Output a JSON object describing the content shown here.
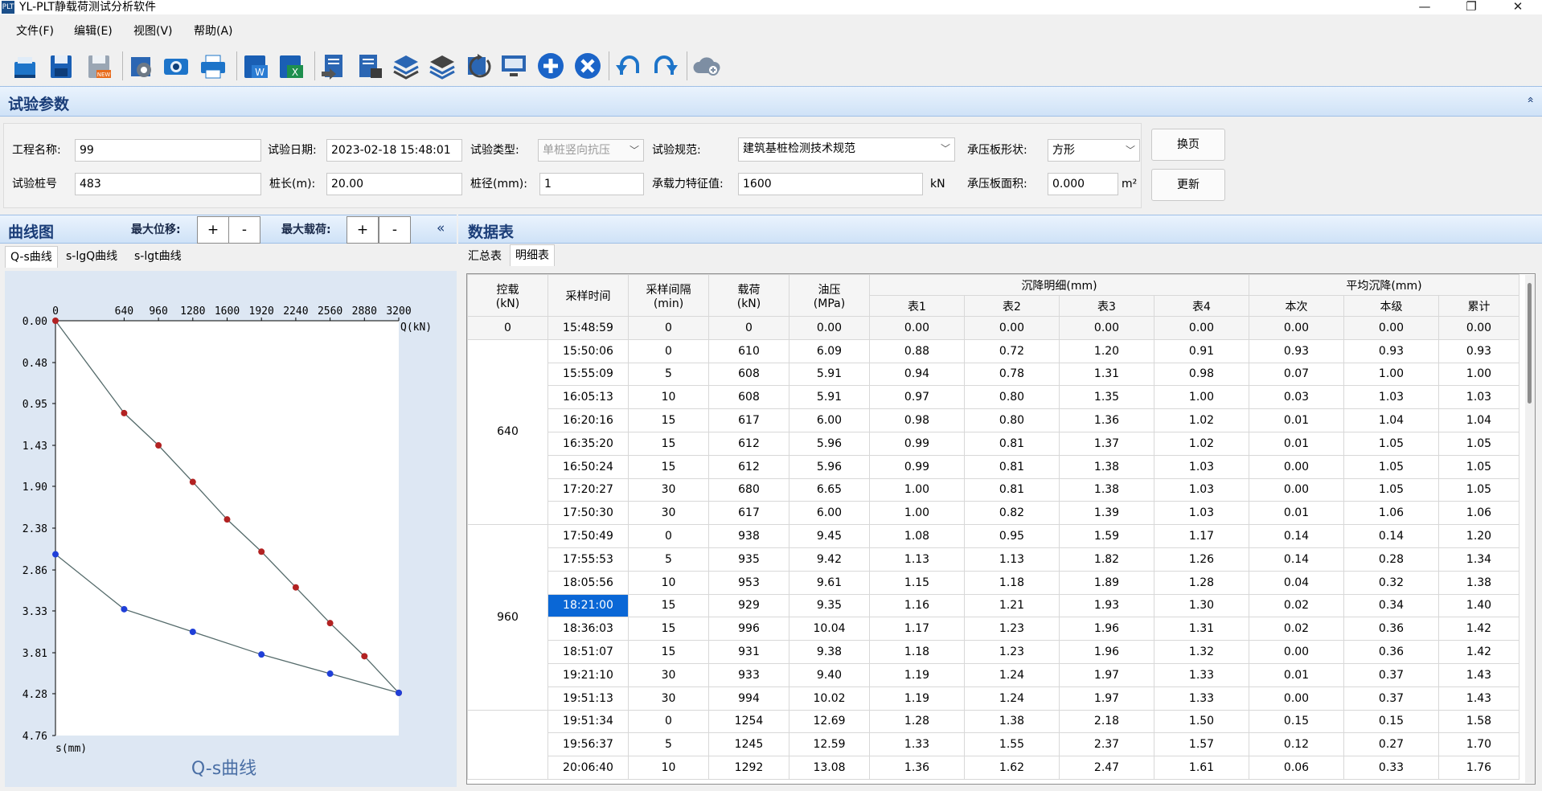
{
  "window": {
    "title": "YL-PLT静载荷测试分析软件",
    "app_icon": "PLT",
    "controls": [
      "—",
      "❐",
      "✕"
    ]
  },
  "menu": [
    "文件(F)",
    "编辑(E)",
    "视图(V)",
    "帮助(A)"
  ],
  "toolbar_icons": [
    "open-icon",
    "save-icon",
    "new-icon",
    "settings-icon",
    "camera-icon",
    "print-icon",
    "export-word-icon",
    "export-excel-icon",
    "import-icon",
    "import-data-icon",
    "layers-icon",
    "layers-multi-icon",
    "refresh-icon",
    "screen-icon",
    "add-icon",
    "delete-icon",
    "undo-icon",
    "redo-icon",
    "cloud-upload-icon"
  ],
  "params": {
    "title": "试验参数",
    "collapse": "«",
    "project_name_label": "工程名称:",
    "project_name": "99",
    "test_date_label": "试验日期:",
    "test_date": "2023-02-18 15:48:01",
    "test_type_label": "试验类型:",
    "test_type": "单桩竖向抗压",
    "spec_label": "试验规范:",
    "spec": "建筑基桩检测技术规范",
    "plate_shape_label": "承压板形状:",
    "plate_shape": "方形",
    "change_page": "换页",
    "pile_no_label": "试验桩号",
    "pile_no": "483",
    "pile_len_label": "桩长(m):",
    "pile_len": "20.00",
    "pile_dia_label": "桩径(mm):",
    "pile_dia": "1",
    "bearing_label": "承载力特征值:",
    "bearing": "1600",
    "bearing_unit": "kN",
    "plate_area_label": "承压板面积:",
    "plate_area": "0.000",
    "plate_area_unit": "m²",
    "update": "更新"
  },
  "curve": {
    "title": "曲线图",
    "max_disp_label": "最大位移:",
    "max_load_label": "最大载荷:",
    "plus": "+",
    "minus": "-",
    "collapse": "«",
    "tabs": [
      "Q-s曲线",
      "s-lgQ曲线",
      "s-lgt曲线"
    ]
  },
  "chart_data": {
    "type": "line",
    "title": "Q-s曲线",
    "xlabel": "Q(kN)",
    "ylabel": "s(mm)",
    "x_ticks": [
      0,
      640,
      960,
      1280,
      1600,
      1920,
      2240,
      2560,
      2880,
      3200
    ],
    "y_ticks": [
      "0.00",
      "0.48",
      "0.95",
      "1.43",
      "1.90",
      "2.38",
      "2.86",
      "3.33",
      "3.81",
      "4.28",
      "4.76"
    ],
    "xlim": [
      0,
      3200
    ],
    "ylim": [
      0,
      4.76
    ],
    "series": [
      {
        "color": "#b22222",
        "x": [
          0,
          640,
          960,
          1280,
          1600,
          1920,
          2240,
          2560,
          2880,
          3200
        ],
        "y": [
          0.0,
          1.06,
          1.43,
          1.85,
          2.28,
          2.65,
          3.06,
          3.47,
          3.85,
          4.27
        ]
      },
      {
        "color": "#1f3fd8",
        "x": [
          3200,
          2560,
          1920,
          1280,
          640,
          0
        ],
        "y": [
          4.27,
          4.05,
          3.83,
          3.57,
          3.31,
          2.68
        ]
      }
    ]
  },
  "datatable": {
    "title": "数据表",
    "tabs": [
      "汇总表",
      "明细表"
    ],
    "header": {
      "load": "控载\n(kN)",
      "time": "采样时间",
      "interval": "采样间隔\n(min)",
      "kn": "载荷\n(kN)",
      "oil": "油压\n(MPa)",
      "settle_detail": "沉降明细(mm)",
      "avg_settle": "平均沉降(mm)",
      "gauges": [
        "表1",
        "表2",
        "表3",
        "表4"
      ],
      "avg_cols": [
        "本次",
        "本级",
        "累计"
      ]
    },
    "groups": [
      {
        "load": "0",
        "rows": [
          [
            "15:48:59",
            "0",
            "0",
            "0.00",
            "0.00",
            "0.00",
            "0.00",
            "0.00",
            "0.00",
            "0.00",
            "0.00"
          ]
        ]
      },
      {
        "load": "640",
        "rows": [
          [
            "15:50:06",
            "0",
            "610",
            "6.09",
            "0.88",
            "0.72",
            "1.20",
            "0.91",
            "0.93",
            "0.93",
            "0.93"
          ],
          [
            "15:55:09",
            "5",
            "608",
            "5.91",
            "0.94",
            "0.78",
            "1.31",
            "0.98",
            "0.07",
            "1.00",
            "1.00"
          ],
          [
            "16:05:13",
            "10",
            "608",
            "5.91",
            "0.97",
            "0.80",
            "1.35",
            "1.00",
            "0.03",
            "1.03",
            "1.03"
          ],
          [
            "16:20:16",
            "15",
            "617",
            "6.00",
            "0.98",
            "0.80",
            "1.36",
            "1.02",
            "0.01",
            "1.04",
            "1.04"
          ],
          [
            "16:35:20",
            "15",
            "612",
            "5.96",
            "0.99",
            "0.81",
            "1.37",
            "1.02",
            "0.01",
            "1.05",
            "1.05"
          ],
          [
            "16:50:24",
            "15",
            "612",
            "5.96",
            "0.99",
            "0.81",
            "1.38",
            "1.03",
            "0.00",
            "1.05",
            "1.05"
          ],
          [
            "17:20:27",
            "30",
            "680",
            "6.65",
            "1.00",
            "0.81",
            "1.38",
            "1.03",
            "0.00",
            "1.05",
            "1.05"
          ],
          [
            "17:50:30",
            "30",
            "617",
            "6.00",
            "1.00",
            "0.82",
            "1.39",
            "1.03",
            "0.01",
            "1.06",
            "1.06"
          ]
        ]
      },
      {
        "load": "960",
        "rows": [
          [
            "17:50:49",
            "0",
            "938",
            "9.45",
            "1.08",
            "0.95",
            "1.59",
            "1.17",
            "0.14",
            "0.14",
            "1.20"
          ],
          [
            "17:55:53",
            "5",
            "935",
            "9.42",
            "1.13",
            "1.13",
            "1.82",
            "1.26",
            "0.14",
            "0.28",
            "1.34"
          ],
          [
            "18:05:56",
            "10",
            "953",
            "9.61",
            "1.15",
            "1.18",
            "1.89",
            "1.28",
            "0.04",
            "0.32",
            "1.38"
          ],
          [
            "18:21:00",
            "15",
            "929",
            "9.35",
            "1.16",
            "1.21",
            "1.93",
            "1.30",
            "0.02",
            "0.34",
            "1.40"
          ],
          [
            "18:36:03",
            "15",
            "996",
            "10.04",
            "1.17",
            "1.23",
            "1.96",
            "1.31",
            "0.02",
            "0.36",
            "1.42"
          ],
          [
            "18:51:07",
            "15",
            "931",
            "9.38",
            "1.18",
            "1.23",
            "1.96",
            "1.32",
            "0.00",
            "0.36",
            "1.42"
          ],
          [
            "19:21:10",
            "30",
            "933",
            "9.40",
            "1.19",
            "1.24",
            "1.97",
            "1.33",
            "0.01",
            "0.37",
            "1.43"
          ],
          [
            "19:51:13",
            "30",
            "994",
            "10.02",
            "1.19",
            "1.24",
            "1.97",
            "1.33",
            "0.00",
            "0.37",
            "1.43"
          ]
        ]
      },
      {
        "load": "",
        "rows": [
          [
            "19:51:34",
            "0",
            "1254",
            "12.69",
            "1.28",
            "1.38",
            "2.18",
            "1.50",
            "0.15",
            "0.15",
            "1.58"
          ],
          [
            "19:56:37",
            "5",
            "1245",
            "12.59",
            "1.33",
            "1.55",
            "2.37",
            "1.57",
            "0.12",
            "0.27",
            "1.70"
          ],
          [
            "20:06:40",
            "10",
            "1292",
            "13.08",
            "1.36",
            "1.62",
            "2.47",
            "1.61",
            "0.06",
            "0.33",
            "1.76"
          ]
        ]
      }
    ],
    "selected_time": "18:21:00"
  }
}
